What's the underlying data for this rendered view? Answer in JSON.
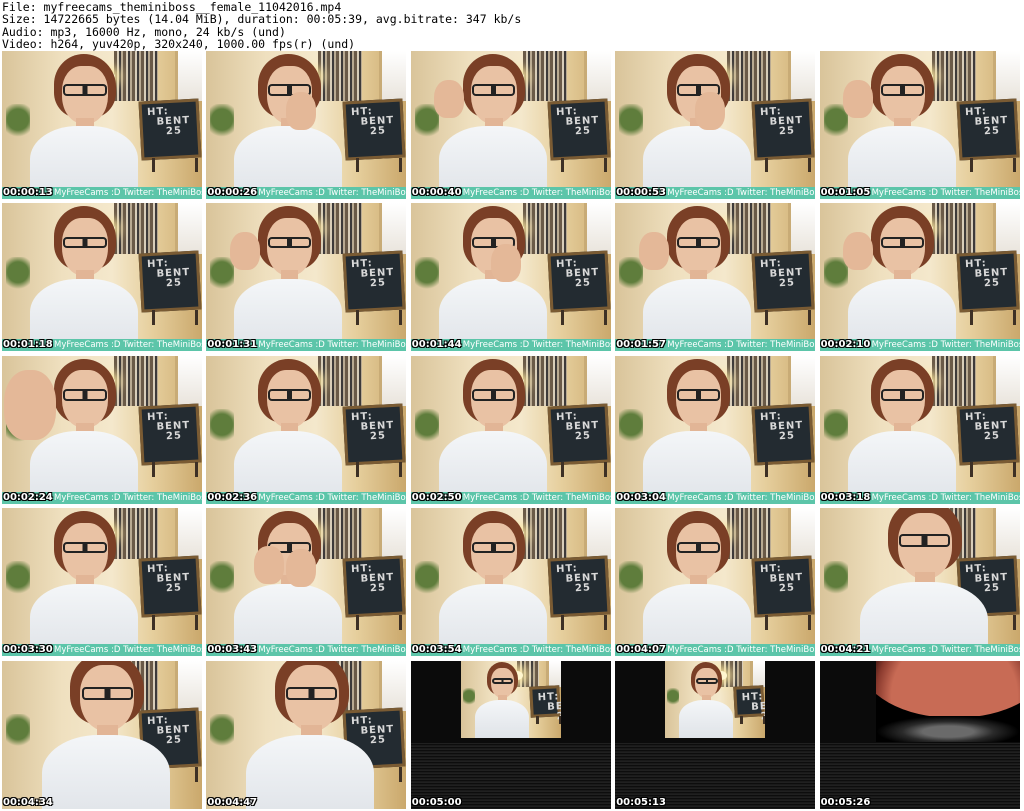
{
  "header": {
    "file_line": "File: myfreecams_theminiboss__female_11042016.mp4",
    "size_line": "Size: 14722665 bytes (14.04 MiB), duration: 00:05:39, avg.bitrate: 347 kb/s",
    "audio_line": "Audio: mp3, 16000 Hz, mono, 24 kb/s (und)",
    "video_line": "Video: h264, yuv420p, 320x240, 1000.00 fps(r) (und)"
  },
  "overlay_caption": "MyFreeCams :D Twitter: TheMiniBoss_",
  "board_text": "HT:\n  BENT\n    25",
  "colors": {
    "caption_bar": "#5cc5a9",
    "timestamp_text": "#ffffff"
  },
  "thumbnails": [
    {
      "time": "00:00:13",
      "kind": "cam",
      "pose": "neutral"
    },
    {
      "time": "00:00:26",
      "kind": "cam",
      "pose": "hand-face"
    },
    {
      "time": "00:00:40",
      "kind": "cam",
      "pose": "wave-left"
    },
    {
      "time": "00:00:53",
      "kind": "cam",
      "pose": "hand-face"
    },
    {
      "time": "00:01:05",
      "kind": "cam",
      "pose": "wave-left"
    },
    {
      "time": "00:01:18",
      "kind": "cam",
      "pose": "neutral"
    },
    {
      "time": "00:01:31",
      "kind": "cam",
      "pose": "wave-left"
    },
    {
      "time": "00:01:44",
      "kind": "cam",
      "pose": "hand-face"
    },
    {
      "time": "00:01:57",
      "kind": "cam",
      "pose": "wave-left"
    },
    {
      "time": "00:02:10",
      "kind": "cam",
      "pose": "wave-left"
    },
    {
      "time": "00:02:24",
      "kind": "cam",
      "pose": "wave-big"
    },
    {
      "time": "00:02:36",
      "kind": "cam",
      "pose": "neutral"
    },
    {
      "time": "00:02:50",
      "kind": "cam",
      "pose": "neutral"
    },
    {
      "time": "00:03:04",
      "kind": "cam",
      "pose": "neutral"
    },
    {
      "time": "00:03:18",
      "kind": "cam",
      "pose": "neutral"
    },
    {
      "time": "00:03:30",
      "kind": "cam",
      "pose": "neutral"
    },
    {
      "time": "00:03:43",
      "kind": "cam",
      "pose": "glasses"
    },
    {
      "time": "00:03:54",
      "kind": "cam",
      "pose": "neutral"
    },
    {
      "time": "00:04:07",
      "kind": "cam",
      "pose": "neutral"
    },
    {
      "time": "00:04:21",
      "kind": "cam",
      "pose": "close"
    },
    {
      "time": "00:04:34",
      "kind": "cam-nobar",
      "pose": "close"
    },
    {
      "time": "00:04:47",
      "kind": "cam-nobar",
      "pose": "close"
    },
    {
      "time": "00:05:00",
      "kind": "dark-mini",
      "pose": "neutral"
    },
    {
      "time": "00:05:13",
      "kind": "dark-mini",
      "pose": "neutral"
    },
    {
      "time": "00:05:26",
      "kind": "dark-planet",
      "pose": "none"
    }
  ]
}
